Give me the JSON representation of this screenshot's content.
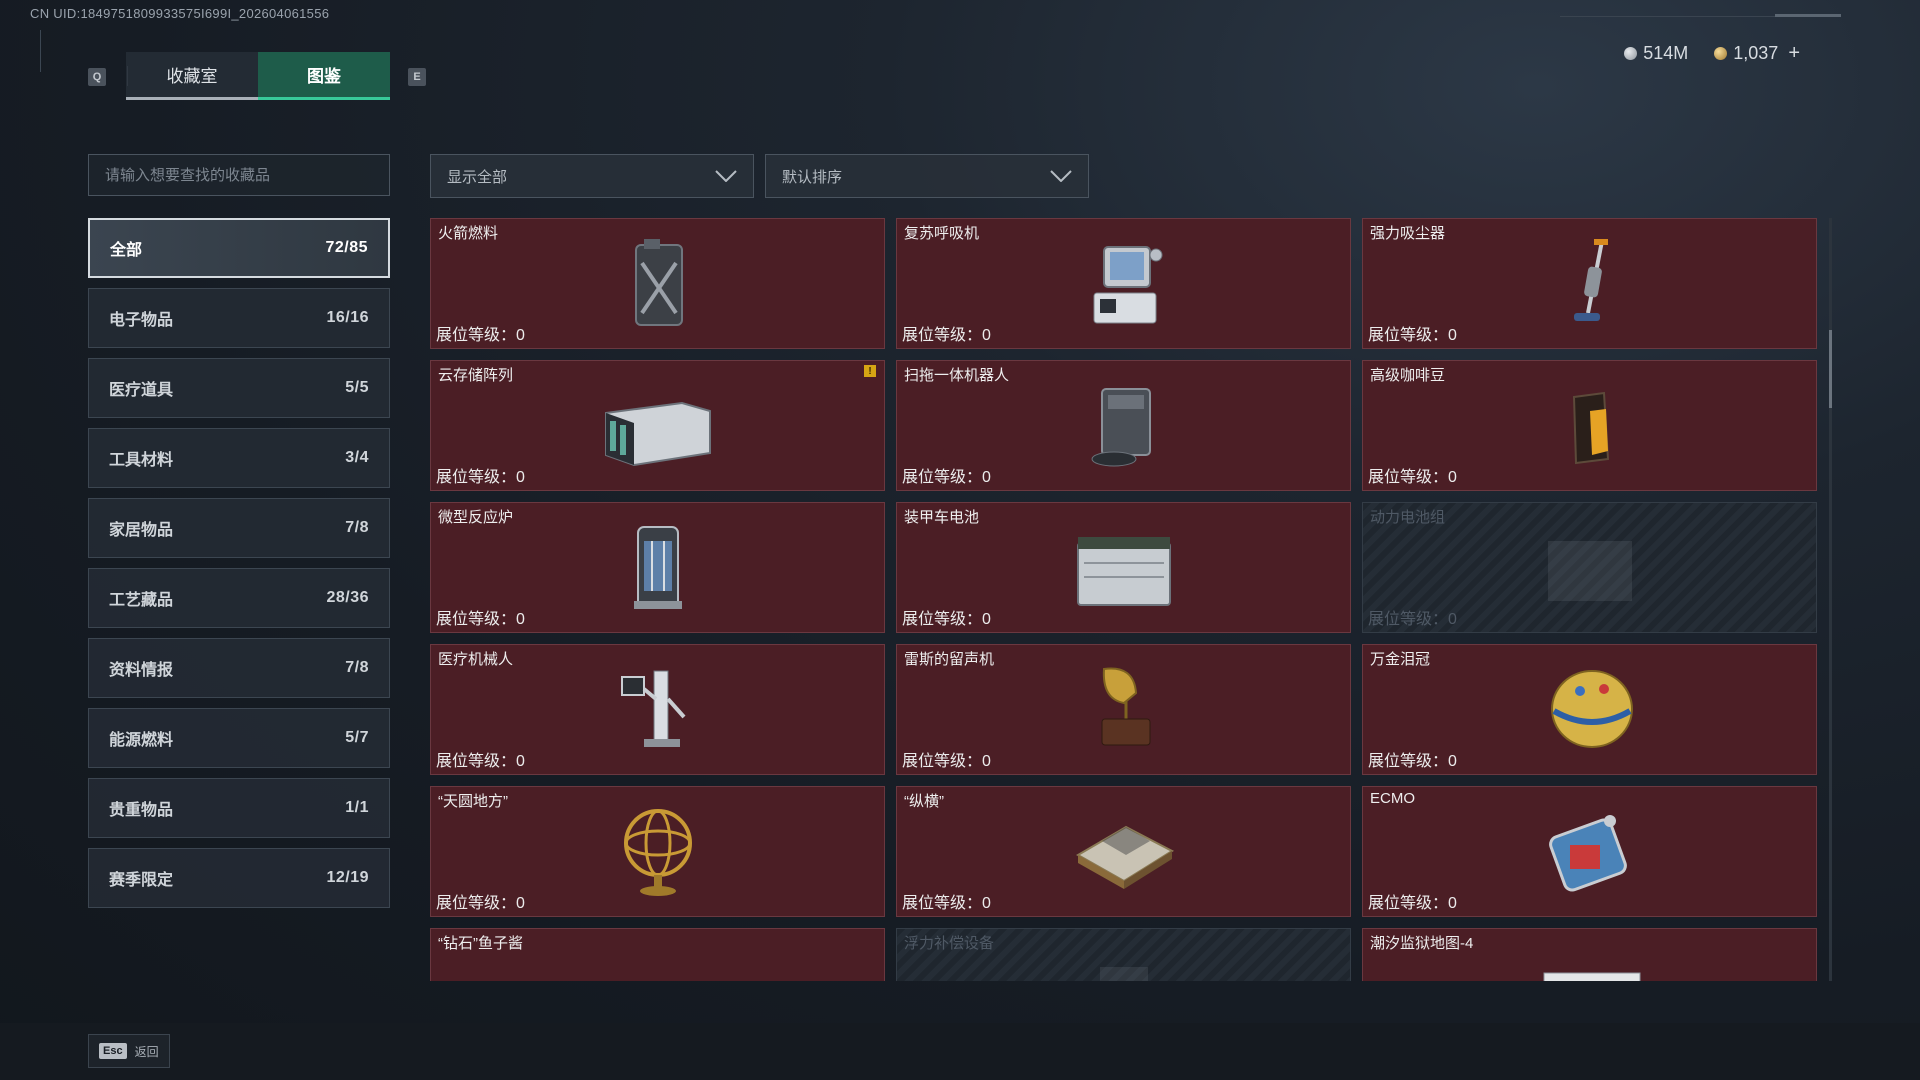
{
  "header": {
    "uid": "CN UID:1849751809933575I699I_202604061556",
    "key_left": "Q",
    "key_right": "E",
    "tabs": [
      {
        "label": "收藏室",
        "active": false
      },
      {
        "label": "图鉴",
        "active": true
      }
    ],
    "currency": {
      "silver": "514M",
      "gold": "1,037",
      "add": "+"
    }
  },
  "search": {
    "placeholder": "请输入想要查找的收藏品"
  },
  "filters": {
    "show": "显示全部",
    "sort": "默认排序"
  },
  "categories": [
    {
      "label": "全部",
      "count": "72/85",
      "active": true
    },
    {
      "label": "电子物品",
      "count": "16/16"
    },
    {
      "label": "医疗道具",
      "count": "5/5"
    },
    {
      "label": "工具材料",
      "count": "3/4"
    },
    {
      "label": "家居物品",
      "count": "7/8"
    },
    {
      "label": "工艺藏品",
      "count": "28/36"
    },
    {
      "label": "资料情报",
      "count": "7/8"
    },
    {
      "label": "能源燃料",
      "count": "5/7"
    },
    {
      "label": "贵重物品",
      "count": "1/1"
    },
    {
      "label": "赛季限定",
      "count": "12/19"
    }
  ],
  "level_label": "展位等级：0",
  "items": [
    {
      "name": "火箭燃料",
      "icon": "fuel-canister-icon",
      "locked": false
    },
    {
      "name": "复苏呼吸机",
      "icon": "ventilator-icon",
      "locked": false
    },
    {
      "name": "强力吸尘器",
      "icon": "vacuum-icon",
      "locked": false
    },
    {
      "name": "云存储阵列",
      "icon": "storage-array-icon",
      "locked": false,
      "alert": "!"
    },
    {
      "name": "扫拖一体机器人",
      "icon": "robot-mop-icon",
      "locked": false
    },
    {
      "name": "高级咖啡豆",
      "icon": "coffee-bag-icon",
      "locked": false
    },
    {
      "name": "微型反应炉",
      "icon": "reactor-icon",
      "locked": false
    },
    {
      "name": "装甲车电池",
      "icon": "battery-icon",
      "locked": false
    },
    {
      "name": "动力电池组",
      "icon": "battery-pack-icon",
      "locked": true
    },
    {
      "name": "医疗机械人",
      "icon": "medical-robot-icon",
      "locked": false
    },
    {
      "name": "雷斯的留声机",
      "icon": "gramophone-icon",
      "locked": false
    },
    {
      "name": "万金泪冠",
      "icon": "jeweled-egg-icon",
      "locked": false
    },
    {
      "name": "“天圆地方”",
      "icon": "armillary-icon",
      "locked": false
    },
    {
      "name": "“纵横”",
      "icon": "chessboard-icon",
      "locked": false
    },
    {
      "name": "ECMO",
      "icon": "ecmo-icon",
      "locked": false
    },
    {
      "name": "“钻石”鱼子酱",
      "icon": "caviar-tin-icon",
      "locked": false
    },
    {
      "name": "浮力补偿设备",
      "icon": "bcd-icon",
      "locked": true
    },
    {
      "name": "潮汐监狱地图-4",
      "icon": "map-icon",
      "locked": false
    }
  ],
  "footer": {
    "esc": "Esc",
    "back": "返回"
  }
}
